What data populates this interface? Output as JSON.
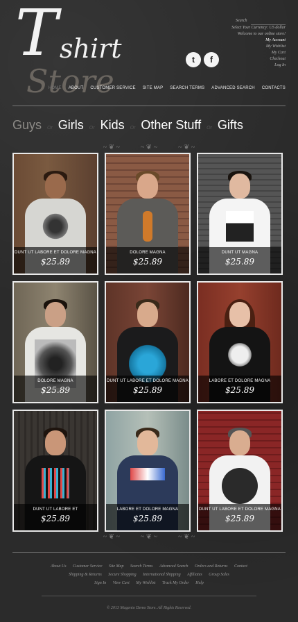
{
  "logo": {
    "t": "T",
    "shirt": "shirt",
    "store": "Store"
  },
  "top_links": {
    "search_label": "Search",
    "currency_label": "Select Your Currency:",
    "currency_value": "US dollar",
    "welcome": "Welcome to our online store!",
    "account": "My Account",
    "wishlist": "My Wishlist",
    "cart": "My Cart",
    "checkout": "Checkout",
    "login": "Log In"
  },
  "social": {
    "twitter": "t",
    "facebook": "f"
  },
  "nav": [
    "HOME",
    "ABOUT",
    "CUSTOMER SERVICE",
    "SITE MAP",
    "SEARCH TERMS",
    "ADVANCED SEARCH",
    "CONTACTS"
  ],
  "categories": [
    "Guys",
    "Girls",
    "Kids",
    "Other Stuff",
    "Gifts"
  ],
  "separator": "Or",
  "products": [
    {
      "name": "DUNT UT LABORE ET DOLORE MAGNA",
      "price": "$25.89"
    },
    {
      "name": "DOLORE MAGNA",
      "price": "$25.89"
    },
    {
      "name": "DUNT UT MAGNA",
      "price": "$25.89"
    },
    {
      "name": "DOLORE MAGNA",
      "price": "$25.89"
    },
    {
      "name": "DUNT UT LABORE ET DOLORE MAGNA",
      "price": "$25.89"
    },
    {
      "name": "LABORE ET DOLORE MAGNA",
      "price": "$25.89"
    },
    {
      "name": "DUNT UT LABORE ET",
      "price": "$25.89"
    },
    {
      "name": "LABORE ET DOLORE MAGNA",
      "price": "$25.89"
    },
    {
      "name": "DUNT UT LABORE ET DOLORE MAGNA",
      "price": "$25.89"
    }
  ],
  "footer": {
    "row1": [
      "About Us",
      "Customer Service",
      "Site Map",
      "Search Terms",
      "Advanced Search",
      "Orders and Returns",
      "Contact"
    ],
    "row2": [
      "Shipping & Returns",
      "Secure Shopping",
      "International Shipping",
      "Affiliates",
      "Group Sales"
    ],
    "row3": [
      "Sign In",
      "View Cart",
      "My Wishlist",
      "Track My Order",
      "Help"
    ]
  },
  "copyright": "© 2013 Magento Demo Store. All Rights Reserved.",
  "colors": {
    "background": "#2b2b2b",
    "card_border": "#e9e9e9",
    "active_category": "#8c8a86"
  }
}
